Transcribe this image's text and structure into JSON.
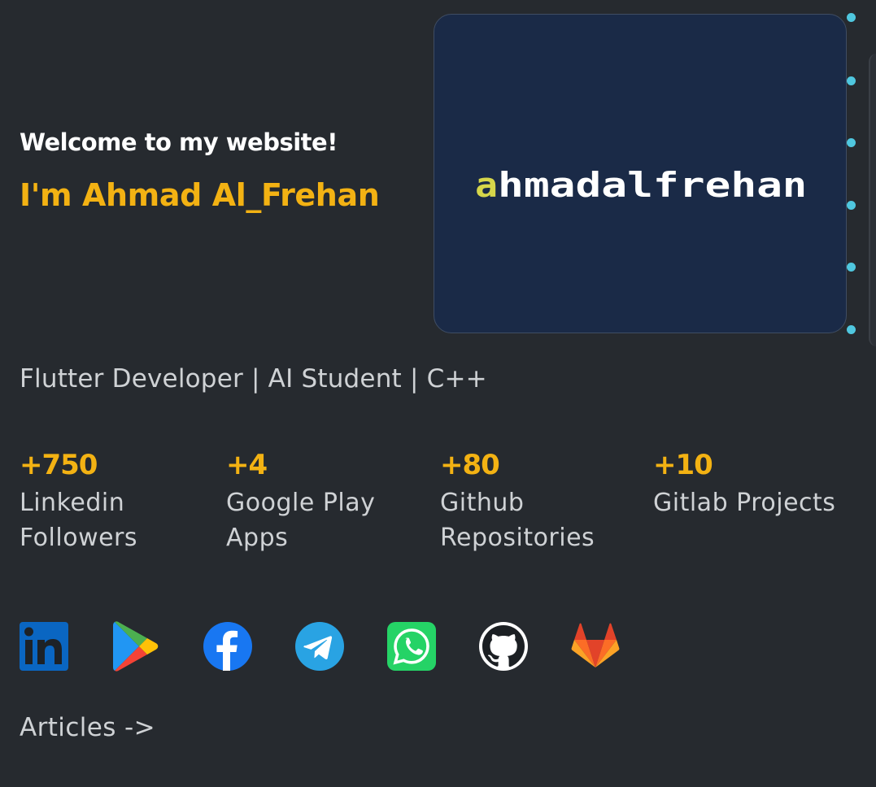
{
  "hero": {
    "welcome": "Welcome to my website!",
    "name": "I'm Ahmad Al_Frehan",
    "tagline": "Flutter Developer | AI Student | C++"
  },
  "logo": {
    "text": "ahmadalfrehan",
    "card_color": "#1a2a47",
    "accent_color": "#d6d64a",
    "text_color": "#ffffff"
  },
  "stats": [
    {
      "value": "+750",
      "label_line1": "Linkedin",
      "label_line2": "Followers"
    },
    {
      "value": "+4",
      "label_line1": "Google Play",
      "label_line2": "Apps"
    },
    {
      "value": "+80",
      "label_line1": "Github",
      "label_line2": "Repositories"
    },
    {
      "value": "+10",
      "label_line1": "Gitlab Projects",
      "label_line2": ""
    }
  ],
  "social": [
    {
      "icon": "linkedin-icon"
    },
    {
      "icon": "google-play-icon"
    },
    {
      "icon": "facebook-icon"
    },
    {
      "icon": "telegram-icon"
    },
    {
      "icon": "whatsapp-icon"
    },
    {
      "icon": "github-icon"
    },
    {
      "icon": "gitlab-icon"
    }
  ],
  "articles_link": "Articles ->",
  "colors": {
    "background": "#262a2f",
    "accent": "#f3b213",
    "text": "#cfd2d5",
    "dot": "#4fc7df"
  }
}
